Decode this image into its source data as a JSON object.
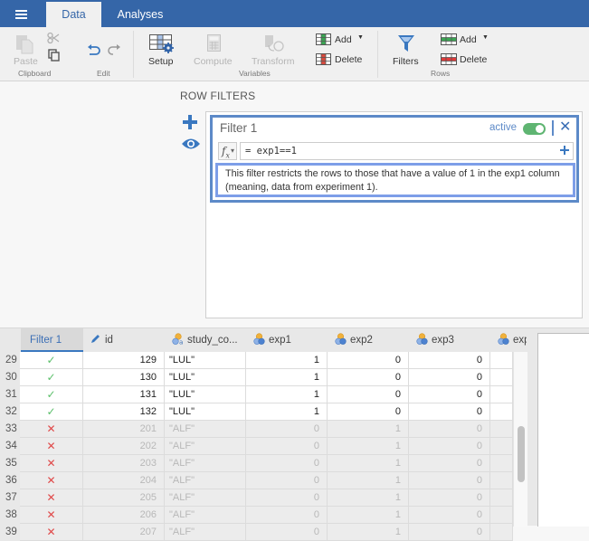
{
  "topbar": {
    "menu_icon": "hamburger-menu-icon",
    "tabs": [
      {
        "label": "Data",
        "active": true
      },
      {
        "label": "Analyses",
        "active": false
      }
    ]
  },
  "ribbon": {
    "groups": {
      "clipboard": "Clipboard",
      "edit": "Edit",
      "variables": "Variables",
      "rows": "Rows"
    },
    "buttons": {
      "paste": "Paste",
      "setup": "Setup",
      "compute": "Compute",
      "transform": "Transform",
      "var_add": "Add",
      "var_delete": "Delete",
      "filters": "Filters",
      "row_add": "Add",
      "row_delete": "Delete"
    }
  },
  "row_filters": {
    "title": "ROW FILTERS",
    "filter": {
      "name": "Filter 1",
      "status_label": "active",
      "active": true,
      "formula": "= exp1==1",
      "description": "This filter restricts the rows to those that have a value of 1 in the exp1 column (meaning, data from experiment 1)."
    }
  },
  "grid": {
    "columns": [
      {
        "name": "Filter 1",
        "type": "filter"
      },
      {
        "name": "id",
        "type": "id"
      },
      {
        "name": "study_co...",
        "type": "nominal-text"
      },
      {
        "name": "exp1",
        "type": "nominal"
      },
      {
        "name": "exp2",
        "type": "nominal"
      },
      {
        "name": "exp3",
        "type": "nominal"
      },
      {
        "name": "exp",
        "type": "nominal"
      }
    ],
    "rows": [
      {
        "n": "29",
        "included": true,
        "id": "129",
        "study": "\"LUL\"",
        "exp1": "1",
        "exp2": "0",
        "exp3": "0"
      },
      {
        "n": "30",
        "included": true,
        "id": "130",
        "study": "\"LUL\"",
        "exp1": "1",
        "exp2": "0",
        "exp3": "0"
      },
      {
        "n": "31",
        "included": true,
        "id": "131",
        "study": "\"LUL\"",
        "exp1": "1",
        "exp2": "0",
        "exp3": "0"
      },
      {
        "n": "32",
        "included": true,
        "id": "132",
        "study": "\"LUL\"",
        "exp1": "1",
        "exp2": "0",
        "exp3": "0"
      },
      {
        "n": "33",
        "included": false,
        "id": "201",
        "study": "\"ALF\"",
        "exp1": "0",
        "exp2": "1",
        "exp3": "0"
      },
      {
        "n": "34",
        "included": false,
        "id": "202",
        "study": "\"ALF\"",
        "exp1": "0",
        "exp2": "1",
        "exp3": "0"
      },
      {
        "n": "35",
        "included": false,
        "id": "203",
        "study": "\"ALF\"",
        "exp1": "0",
        "exp2": "1",
        "exp3": "0"
      },
      {
        "n": "36",
        "included": false,
        "id": "204",
        "study": "\"ALF\"",
        "exp1": "0",
        "exp2": "1",
        "exp3": "0"
      },
      {
        "n": "37",
        "included": false,
        "id": "205",
        "study": "\"ALF\"",
        "exp1": "0",
        "exp2": "1",
        "exp3": "0"
      },
      {
        "n": "38",
        "included": false,
        "id": "206",
        "study": "\"ALF\"",
        "exp1": "0",
        "exp2": "1",
        "exp3": "0"
      },
      {
        "n": "39",
        "included": false,
        "id": "207",
        "study": "\"ALF\"",
        "exp1": "0",
        "exp2": "1",
        "exp3": "0"
      }
    ],
    "included_mark": "✓",
    "excluded_mark": "✕"
  },
  "colors": {
    "brand": "#3566a8",
    "accent": "#3a78c0",
    "active_toggle": "#5fb572",
    "excluded": "#e04848",
    "included": "#5bbf6a"
  }
}
